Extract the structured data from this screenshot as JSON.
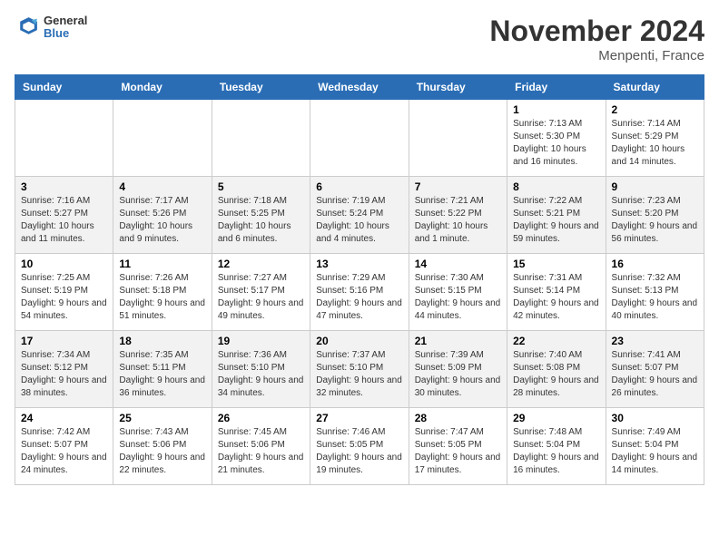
{
  "header": {
    "logo_general": "General",
    "logo_blue": "Blue",
    "month_title": "November 2024",
    "location": "Menpenti, France"
  },
  "days_of_week": [
    "Sunday",
    "Monday",
    "Tuesday",
    "Wednesday",
    "Thursday",
    "Friday",
    "Saturday"
  ],
  "weeks": [
    {
      "shade": "white",
      "days": [
        {
          "date": "",
          "info": ""
        },
        {
          "date": "",
          "info": ""
        },
        {
          "date": "",
          "info": ""
        },
        {
          "date": "",
          "info": ""
        },
        {
          "date": "",
          "info": ""
        },
        {
          "date": "1",
          "info": "Sunrise: 7:13 AM\nSunset: 5:30 PM\nDaylight: 10 hours and 16 minutes."
        },
        {
          "date": "2",
          "info": "Sunrise: 7:14 AM\nSunset: 5:29 PM\nDaylight: 10 hours and 14 minutes."
        }
      ]
    },
    {
      "shade": "shade",
      "days": [
        {
          "date": "3",
          "info": "Sunrise: 7:16 AM\nSunset: 5:27 PM\nDaylight: 10 hours and 11 minutes."
        },
        {
          "date": "4",
          "info": "Sunrise: 7:17 AM\nSunset: 5:26 PM\nDaylight: 10 hours and 9 minutes."
        },
        {
          "date": "5",
          "info": "Sunrise: 7:18 AM\nSunset: 5:25 PM\nDaylight: 10 hours and 6 minutes."
        },
        {
          "date": "6",
          "info": "Sunrise: 7:19 AM\nSunset: 5:24 PM\nDaylight: 10 hours and 4 minutes."
        },
        {
          "date": "7",
          "info": "Sunrise: 7:21 AM\nSunset: 5:22 PM\nDaylight: 10 hours and 1 minute."
        },
        {
          "date": "8",
          "info": "Sunrise: 7:22 AM\nSunset: 5:21 PM\nDaylight: 9 hours and 59 minutes."
        },
        {
          "date": "9",
          "info": "Sunrise: 7:23 AM\nSunset: 5:20 PM\nDaylight: 9 hours and 56 minutes."
        }
      ]
    },
    {
      "shade": "white",
      "days": [
        {
          "date": "10",
          "info": "Sunrise: 7:25 AM\nSunset: 5:19 PM\nDaylight: 9 hours and 54 minutes."
        },
        {
          "date": "11",
          "info": "Sunrise: 7:26 AM\nSunset: 5:18 PM\nDaylight: 9 hours and 51 minutes."
        },
        {
          "date": "12",
          "info": "Sunrise: 7:27 AM\nSunset: 5:17 PM\nDaylight: 9 hours and 49 minutes."
        },
        {
          "date": "13",
          "info": "Sunrise: 7:29 AM\nSunset: 5:16 PM\nDaylight: 9 hours and 47 minutes."
        },
        {
          "date": "14",
          "info": "Sunrise: 7:30 AM\nSunset: 5:15 PM\nDaylight: 9 hours and 44 minutes."
        },
        {
          "date": "15",
          "info": "Sunrise: 7:31 AM\nSunset: 5:14 PM\nDaylight: 9 hours and 42 minutes."
        },
        {
          "date": "16",
          "info": "Sunrise: 7:32 AM\nSunset: 5:13 PM\nDaylight: 9 hours and 40 minutes."
        }
      ]
    },
    {
      "shade": "shade",
      "days": [
        {
          "date": "17",
          "info": "Sunrise: 7:34 AM\nSunset: 5:12 PM\nDaylight: 9 hours and 38 minutes."
        },
        {
          "date": "18",
          "info": "Sunrise: 7:35 AM\nSunset: 5:11 PM\nDaylight: 9 hours and 36 minutes."
        },
        {
          "date": "19",
          "info": "Sunrise: 7:36 AM\nSunset: 5:10 PM\nDaylight: 9 hours and 34 minutes."
        },
        {
          "date": "20",
          "info": "Sunrise: 7:37 AM\nSunset: 5:10 PM\nDaylight: 9 hours and 32 minutes."
        },
        {
          "date": "21",
          "info": "Sunrise: 7:39 AM\nSunset: 5:09 PM\nDaylight: 9 hours and 30 minutes."
        },
        {
          "date": "22",
          "info": "Sunrise: 7:40 AM\nSunset: 5:08 PM\nDaylight: 9 hours and 28 minutes."
        },
        {
          "date": "23",
          "info": "Sunrise: 7:41 AM\nSunset: 5:07 PM\nDaylight: 9 hours and 26 minutes."
        }
      ]
    },
    {
      "shade": "white",
      "days": [
        {
          "date": "24",
          "info": "Sunrise: 7:42 AM\nSunset: 5:07 PM\nDaylight: 9 hours and 24 minutes."
        },
        {
          "date": "25",
          "info": "Sunrise: 7:43 AM\nSunset: 5:06 PM\nDaylight: 9 hours and 22 minutes."
        },
        {
          "date": "26",
          "info": "Sunrise: 7:45 AM\nSunset: 5:06 PM\nDaylight: 9 hours and 21 minutes."
        },
        {
          "date": "27",
          "info": "Sunrise: 7:46 AM\nSunset: 5:05 PM\nDaylight: 9 hours and 19 minutes."
        },
        {
          "date": "28",
          "info": "Sunrise: 7:47 AM\nSunset: 5:05 PM\nDaylight: 9 hours and 17 minutes."
        },
        {
          "date": "29",
          "info": "Sunrise: 7:48 AM\nSunset: 5:04 PM\nDaylight: 9 hours and 16 minutes."
        },
        {
          "date": "30",
          "info": "Sunrise: 7:49 AM\nSunset: 5:04 PM\nDaylight: 9 hours and 14 minutes."
        }
      ]
    }
  ]
}
